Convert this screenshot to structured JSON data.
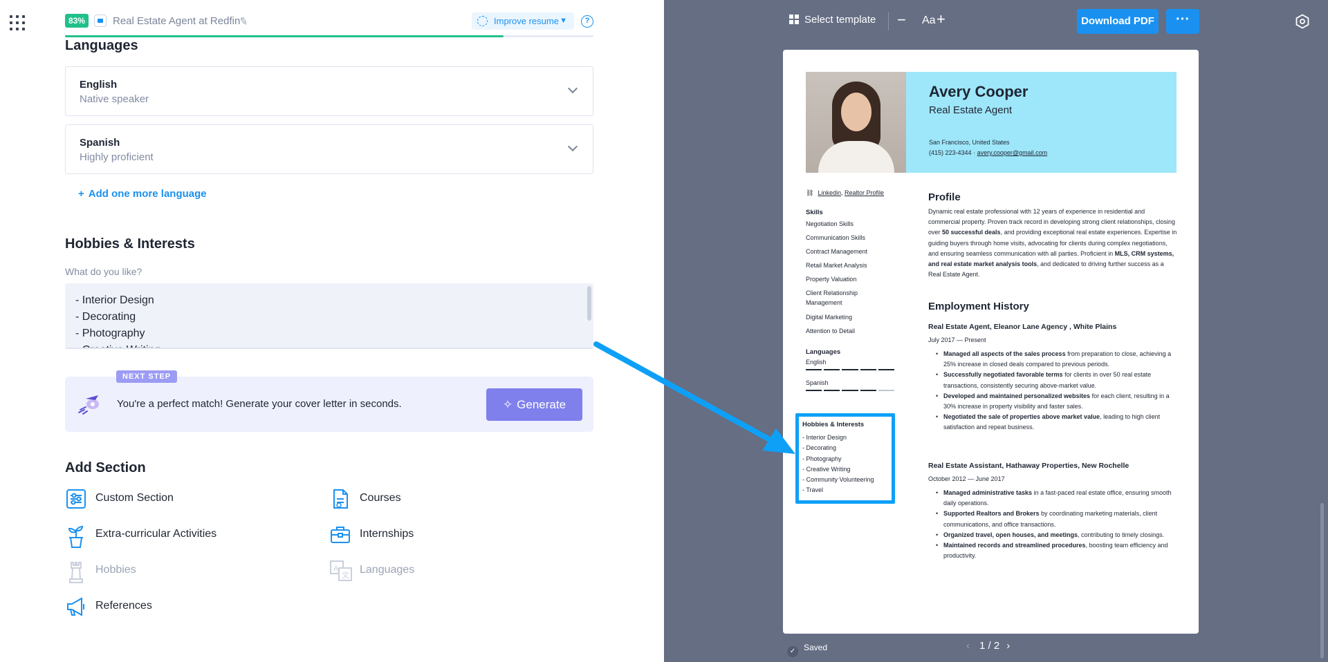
{
  "topbar": {
    "score": "83%",
    "score_fraction": 0.83,
    "job_title": "Real Estate Agent at Redfin",
    "improve_label": "Improve resume"
  },
  "languages": {
    "title": "Languages",
    "items": [
      {
        "name": "English",
        "level": "Native speaker"
      },
      {
        "name": "Spanish",
        "level": "Highly proficient"
      }
    ],
    "add_label": "Add one more language"
  },
  "hobbies": {
    "title": "Hobbies & Interests",
    "prompt": "What do you like?",
    "text": "- Interior Design\n- Decorating\n- Photography\n- Creative Writing"
  },
  "next_step": {
    "badge": "NEXT STEP",
    "message": "You're a perfect match! Generate your cover letter in seconds.",
    "button": "Generate"
  },
  "add_section": {
    "title": "Add Section",
    "items": [
      {
        "label": "Custom Section",
        "enabled": true
      },
      {
        "label": "Courses",
        "enabled": true
      },
      {
        "label": "Extra-curricular Activities",
        "enabled": true
      },
      {
        "label": "Internships",
        "enabled": true
      },
      {
        "label": "Hobbies",
        "enabled": false
      },
      {
        "label": "Languages",
        "enabled": false
      },
      {
        "label": "References",
        "enabled": true
      }
    ]
  },
  "preview_toolbar": {
    "template_label": "Select template",
    "font_label": "Aa",
    "download_label": "Download PDF",
    "more_label": "···"
  },
  "resume": {
    "name": "Avery Cooper",
    "role": "Real Estate Agent",
    "location": "San Francisco, United States",
    "phone": "(415) 223-4344",
    "email": "avery.cooper@gmail.com",
    "links": [
      "Linkedin",
      "Realtor Profile"
    ],
    "skills_title": "Skills",
    "skills": [
      "Negotiation Skills",
      "Communication Skills",
      "Contract Management",
      "Retail Market Analysis",
      "Property Valuation",
      "Client Relationship Management",
      "Digital Marketing",
      "Attention to Detail"
    ],
    "languages_title": "Languages",
    "languages": [
      {
        "name": "English",
        "level": 5
      },
      {
        "name": "Spanish",
        "level": 4
      }
    ],
    "hobbies_title": "Hobbies & Interests",
    "hobbies": "- Interior Design\n- Decorating\n- Photography\n- Creative Writing\n- Community Volunteering\n- Travel",
    "profile_title": "Profile",
    "profile_parts": [
      "Dynamic real estate professional with 12 years of experience in residential and commercial property. Proven track record in developing strong client relationships, closing over ",
      "50 successful deals",
      ", and providing exceptional real estate experiences. Expertise in guiding buyers through home visits, advocating for clients during complex negotiations, and ensuring seamless communication with all parties. Proficient in ",
      "MLS, CRM systems, and real estate market analysis tools",
      ", and dedicated to driving further success as a Real Estate Agent."
    ],
    "employment_title": "Employment History",
    "jobs": [
      {
        "title": "Real Estate Agent, Eleanor Lane Agency , White Plains",
        "dates": "July 2017 — Present",
        "bullets": [
          {
            "bold": "Managed all aspects of the sales process",
            "rest": " from preparation to close, achieving a 25% increase in closed deals compared to previous periods."
          },
          {
            "bold": "Successfully negotiated favorable terms",
            "rest": " for clients in over 50 real estate transactions, consistently securing above-market value."
          },
          {
            "bold": "Developed and maintained personalized websites",
            "rest": " for each client, resulting in a 30% increase in property visibility and faster sales."
          },
          {
            "bold": "Negotiated the sale of properties above market value",
            "rest": ", leading to high client satisfaction and repeat business."
          }
        ]
      },
      {
        "title": "Real Estate Assistant, Hathaway Properties, New Rochelle",
        "dates": "October 2012 — June 2017",
        "bullets": [
          {
            "bold": "Managed administrative tasks",
            "rest": " in a fast-paced real estate office, ensuring smooth daily operations."
          },
          {
            "bold": "Supported Realtors and Brokers",
            "rest": " by coordinating marketing materials, client communications, and office transactions."
          },
          {
            "bold": "Organized travel, open houses, and meetings",
            "rest": ", contributing to timely closings."
          },
          {
            "bold": "Maintained records and streamlined procedures",
            "rest": ", boosting team efficiency and productivity."
          }
        ]
      }
    ]
  },
  "footer": {
    "saved_label": "Saved",
    "page_indicator": "1 / 2"
  },
  "colors": {
    "accent": "#1a91f0",
    "score_green": "#21c08b",
    "preview_bg": "#656e83",
    "header_cyan": "#9ee6fa",
    "highlight_blue": "#0ea0f7",
    "generate_purple": "#7f80ec"
  }
}
